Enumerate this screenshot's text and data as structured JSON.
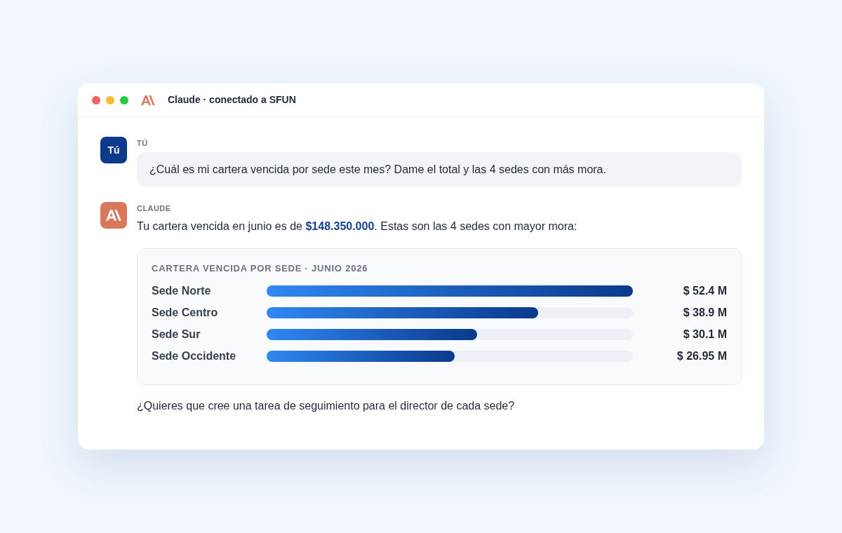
{
  "window": {
    "title": "Claude · conectado a SFUN"
  },
  "messages": [
    {
      "kind": "user",
      "avatar": "Tú",
      "author": "TÚ",
      "text": "¿Cuál es mi cartera vencida por sede este mes? Dame el total y las 4 sedes con más mora."
    },
    {
      "kind": "assistant",
      "author": "CLAUDE",
      "blocks": [
        {
          "kind": "paragraph",
          "text": "Tu cartera vencida en junio es de **$148.350.000**. Estas son las 4 sedes con mayor mora:"
        },
        {
          "kind": "bar_card",
          "title": "CARTERA VENCIDA POR SEDE · JUNIO 2026",
          "rows": [
            {
              "label": "Sede Norte",
              "value": "$ 52.4 M",
              "level": 1.0
            },
            {
              "label": "Sede Centro",
              "value": "$ 38.9 M",
              "level": 0.742
            },
            {
              "label": "Sede Sur",
              "value": "$ 30.1 M",
              "level": 0.574
            },
            {
              "label": "Sede Occidente",
              "value": "$ 26.95 M",
              "level": 0.514
            }
          ]
        },
        {
          "kind": "paragraph",
          "text": "¿Quieres que cree una tarea de seguimiento para el director de cada sede?"
        }
      ]
    }
  ]
}
